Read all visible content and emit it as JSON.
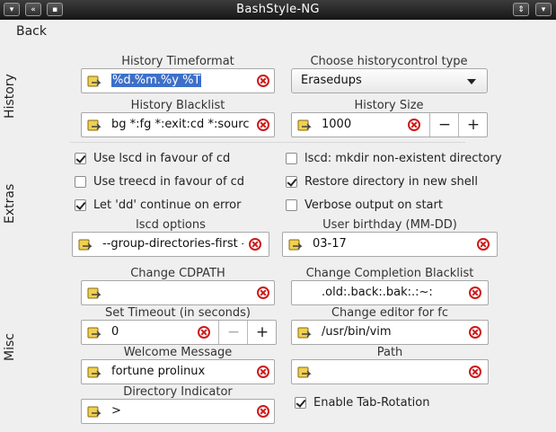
{
  "window": {
    "title": "BashStyle-NG"
  },
  "nav": {
    "back_label": "Back"
  },
  "side_tabs": {
    "history": "History",
    "extras": "Extras",
    "misc": "Misc"
  },
  "history": {
    "timeformat_label": "History Timeformat",
    "timeformat_value": "%d.%m.%y %T",
    "controltype_label": "Choose historycontrol type",
    "controltype_value": "Erasedups",
    "blacklist_label": "History Blacklist",
    "blacklist_value": "bg *:fg *:exit:cd *:source",
    "size_label": "History Size",
    "size_value": "1000"
  },
  "extras": {
    "lscd_cd": {
      "label": "Use lscd in favour of cd",
      "checked": true
    },
    "treecd_cd": {
      "label": "Use treecd in favour of cd",
      "checked": false
    },
    "dd_continue": {
      "label": "Let 'dd' continue on error",
      "checked": true
    },
    "lscd_mkdir": {
      "label": "lscd: mkdir non-existent directory",
      "checked": false
    },
    "restore_dir": {
      "label": "Restore directory in new shell",
      "checked": true
    },
    "verbose_start": {
      "label": "Verbose output on start",
      "checked": false
    },
    "lscd_options_label": "lscd options",
    "lscd_options_value": "--group-directories-first -",
    "birthday_label": "User birthday (MM-DD)",
    "birthday_value": "03-17"
  },
  "misc": {
    "cdpath_label": "Change CDPATH",
    "cdpath_value": "",
    "completion_label": "Change Completion Blacklist",
    "completion_value": ".old:.back:.bak:.:~:",
    "timeout_label": "Set Timeout (in seconds)",
    "timeout_value": "0",
    "editor_label": "Change editor for fc",
    "editor_value": "/usr/bin/vim",
    "welcome_label": "Welcome Message",
    "welcome_value": "fortune prolinux",
    "path_label": "Path",
    "path_value": "",
    "dirindicator_label": "Directory Indicator",
    "dirindicator_value": ">",
    "tabrotation": {
      "label": "Enable Tab-Rotation",
      "checked": true
    }
  },
  "colors": {
    "selection": "#3d6fc9",
    "clear_icon": "#cc1a1a",
    "titlebar": "#2a2a2a"
  },
  "icons": {
    "entry_icon": "edit-paste-icon",
    "clear_icon": "clear-text-icon"
  }
}
